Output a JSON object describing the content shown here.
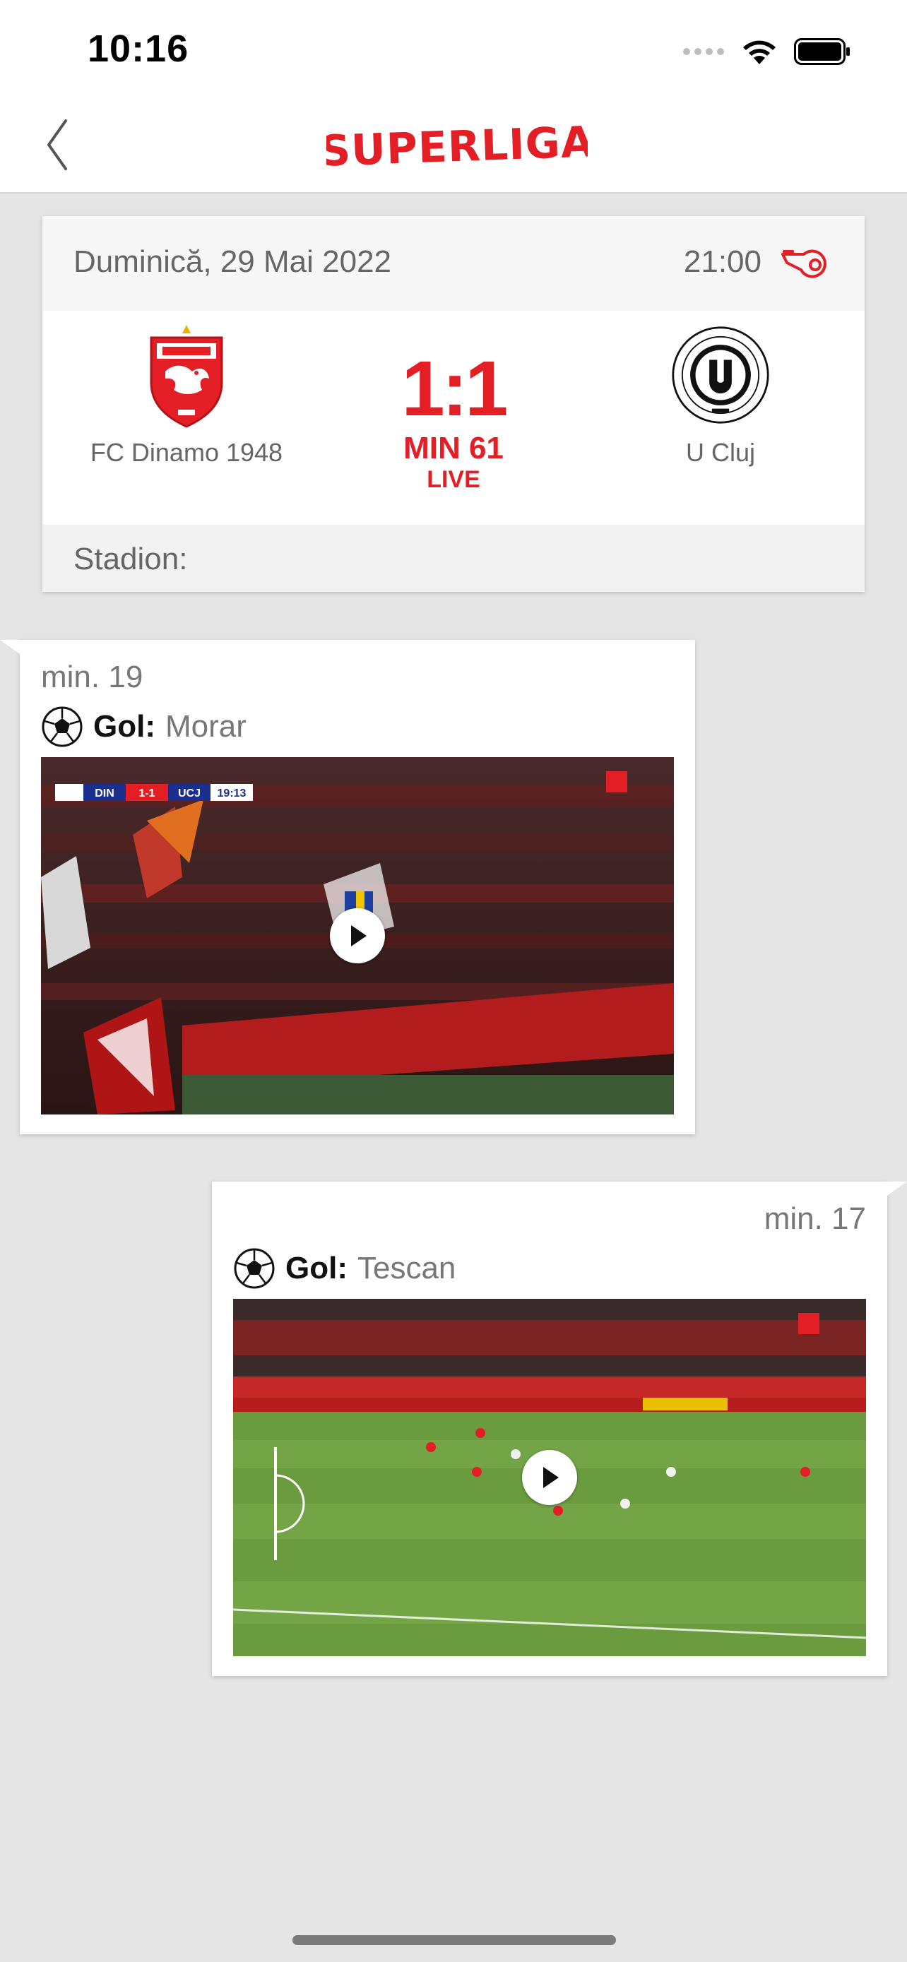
{
  "status_bar": {
    "time": "10:16",
    "icons": [
      "signal-dots-icon",
      "wifi-icon",
      "battery-icon"
    ]
  },
  "nav": {
    "back_icon": "chevron-left-icon",
    "logo_text": "SUPERLIGA"
  },
  "match": {
    "date": "Duminică, 29 Mai 2022",
    "kickoff": "21:00",
    "home_team": "FC Dinamo 1948",
    "away_team": "U Cluj",
    "score": "1:1",
    "minute": "MIN 61",
    "status": "LIVE",
    "stadium_label": "Stadion:"
  },
  "events": [
    {
      "minute": "min. 19",
      "type_label": "Gol:",
      "player": "Morar",
      "side": "home",
      "video_overlay": {
        "home": "DIN",
        "score": "1-1",
        "away": "UCJ",
        "clock": "19:13"
      }
    },
    {
      "minute": "min. 17",
      "type_label": "Gol:",
      "player": "Tescan",
      "side": "away"
    }
  ],
  "colors": {
    "accent": "#e31e24",
    "background": "#e5e5e5",
    "card": "#ffffff",
    "muted_text": "#666666"
  }
}
